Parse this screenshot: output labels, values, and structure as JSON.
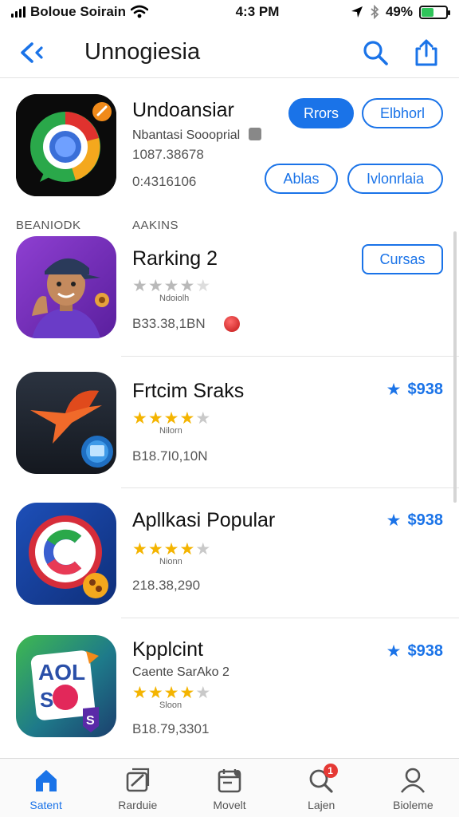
{
  "status_bar": {
    "carrier": "Boloue Soirain",
    "time": "4:3 PM",
    "battery_percent_text": "49%",
    "battery_level": 0.49
  },
  "nav": {
    "title": "Unnogiesia",
    "back_icon": "chevron-left-icon",
    "search_icon": "search-icon",
    "share_icon": "share-icon"
  },
  "sections": {
    "left": "BEANIODK",
    "right": "AAKINS"
  },
  "apps": [
    {
      "title": "Undoansiar",
      "subtitle": "Nbantasi Soooprial",
      "meta1": "1087.38678",
      "meta2": "0:4316106",
      "buttons": [
        "Rrors",
        "Elbhorl",
        "Ablas",
        "Ivlonrlaia"
      ]
    },
    {
      "title": "Rarking 2",
      "stars": 4,
      "rating_label": "Ndoiolh",
      "meta": "B33.38,1BN",
      "button": "Cursas"
    },
    {
      "title": "Frtcim Sraks",
      "stars": 4,
      "rating_label": "Nilorn",
      "meta": "B18.7I0,10N",
      "price": "$938"
    },
    {
      "title": "Apllkasi Popular",
      "stars": 4,
      "rating_label": "Nionn",
      "meta": "218.38,290",
      "price": "$938"
    },
    {
      "title": "Kpplcint",
      "subtitle": "Caente SarAko 2",
      "stars": 4,
      "rating_label": "Sloon",
      "meta": "B18.79,3301",
      "price": "$938"
    }
  ],
  "tabs": [
    {
      "label": "Satent",
      "icon": "home-icon",
      "active": true
    },
    {
      "label": "Rarduie",
      "icon": "news-icon",
      "active": false
    },
    {
      "label": "Movelt",
      "icon": "calendar-icon",
      "active": false
    },
    {
      "label": "Lajen",
      "icon": "search-icon",
      "active": false,
      "badge": "1"
    },
    {
      "label": "Bioleme",
      "icon": "person-icon",
      "active": false
    }
  ],
  "colors": {
    "accent": "#1a73e8",
    "star": "#f4b400",
    "badge": "#e53935",
    "battery": "#2fc45a"
  }
}
